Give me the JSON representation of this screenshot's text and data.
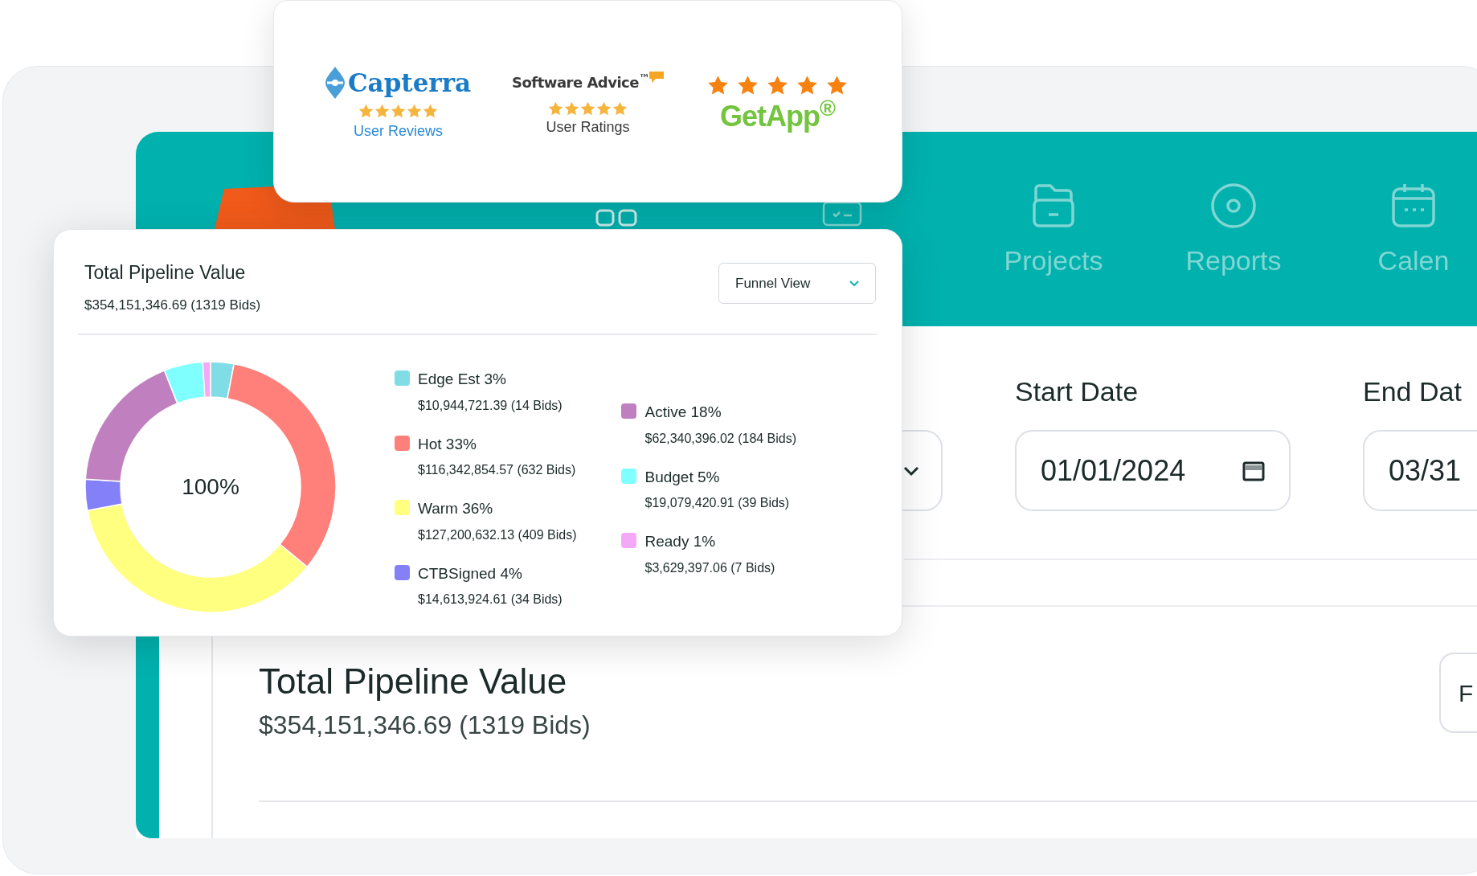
{
  "reviews": [
    {
      "kind": "capterra",
      "logo": "Capterra",
      "stars": 5,
      "caption": "User Reviews"
    },
    {
      "kind": "softwareadvice",
      "logo": "Software Advice$^{™}$",
      "stars": 5,
      "caption": "User Ratings"
    },
    {
      "kind": "getapp",
      "logo": "GetApp$^{®}$",
      "stars": 5
    }
  ],
  "app": {
    "nav": [
      {
        "kind": "folder",
        "label": "Projects"
      },
      {
        "kind": "target",
        "label": "Reports"
      },
      {
        "kind": "calendar",
        "label": "Calen"
      }
    ],
    "filters": {
      "start": {
        "label": "Start Date",
        "value": "01/01/2024"
      },
      "end": {
        "label": "End Dat",
        "value": "03/31"
      }
    },
    "summary": {
      "title": "Total Pipeline Value",
      "amount": "$354,151,346.69 (1319 Bids)",
      "button": "F"
    }
  },
  "pipeline_card": {
    "title": "Total Pipeline Value",
    "amount": "$354,151,346.69 (1319 Bids)",
    "view_select": "Funnel View",
    "center_label": "100%",
    "chart_data": {
      "type": "donut",
      "values": [
        3,
        33,
        36,
        4,
        18,
        5,
        1
      ]
    },
    "legend_columns": [
      [
        {
          "label": "Edge Est 3%",
          "amount": "$10,944,721.39 (14 Bids)",
          "color": "#80dde6"
        },
        {
          "label": "Hot 33%",
          "amount": "$116,342,854.57 (632 Bids)",
          "color": "#ff7f7a"
        },
        {
          "label": "Warm 36%",
          "amount": "$127,200,632.13 (409 Bids)",
          "color": "#ffff80"
        },
        {
          "label": "CTBSigned 4%",
          "amount": "$14,613,924.61 (34 Bids)",
          "color": "#8480f8"
        }
      ],
      [
        {
          "label": "Active 18%",
          "amount": "$62,340,396.02 (184 Bids)",
          "color": "#c080c0"
        },
        {
          "label": "Budget 5%",
          "amount": "$19,079,420.91 (39 Bids)",
          "color": "#80ffff"
        },
        {
          "label": "Ready 1%",
          "amount": "$3,629,397.06 (7 Bids)",
          "color": "#f4a8f8"
        }
      ]
    ]
  }
}
